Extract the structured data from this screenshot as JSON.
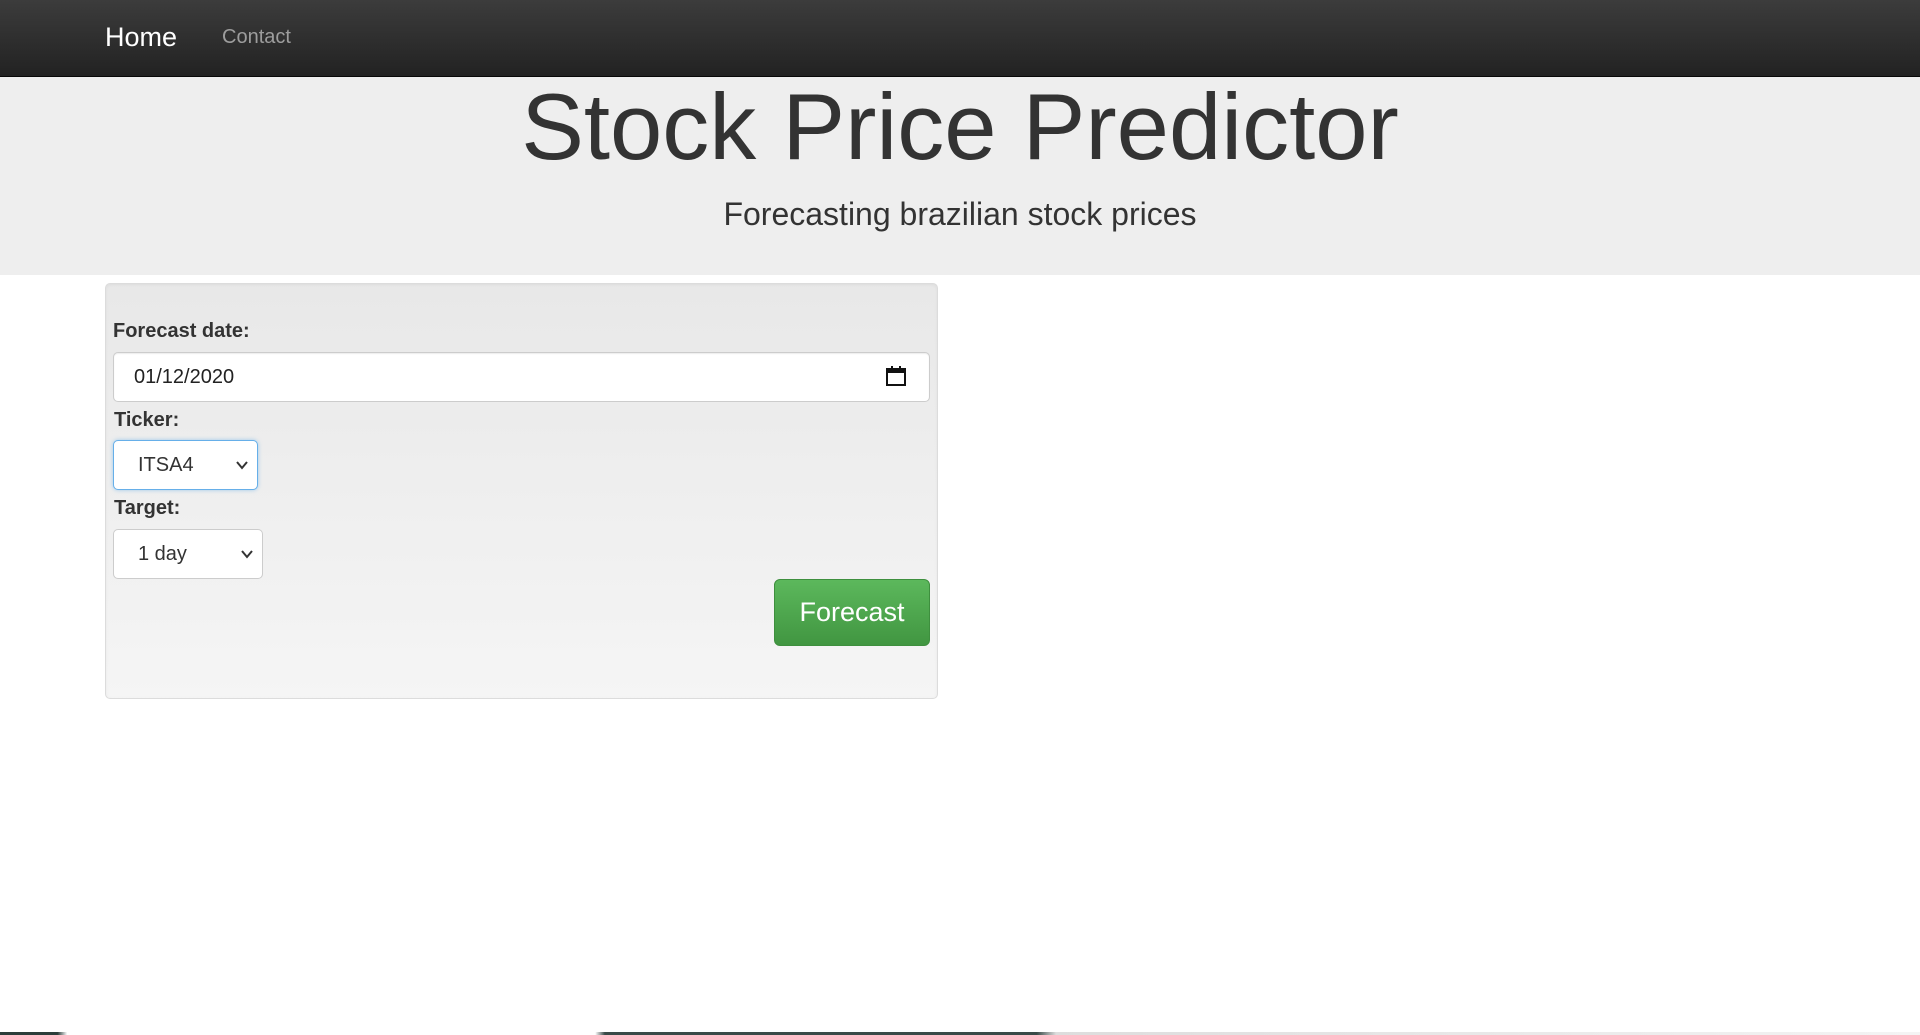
{
  "navbar": {
    "home_label": "Home",
    "contact_label": "Contact"
  },
  "header": {
    "title": "Stock Price Predictor",
    "subtitle": "Forecasting brazilian stock prices"
  },
  "form": {
    "date_label": "Forecast date:",
    "date_value": "01/12/2020",
    "ticker_label": "Ticker:",
    "ticker_value": "ITSA4",
    "target_label": "Target:",
    "target_value": "1 day",
    "submit_label": "Forecast"
  },
  "icons": {
    "calendar": "calendar-icon",
    "chevron": "chevron-down-icon"
  },
  "colors": {
    "navbar": "#222222",
    "jumbotron": "#eeeeee",
    "button": "#5cb85c",
    "focus": "#66afe9"
  }
}
